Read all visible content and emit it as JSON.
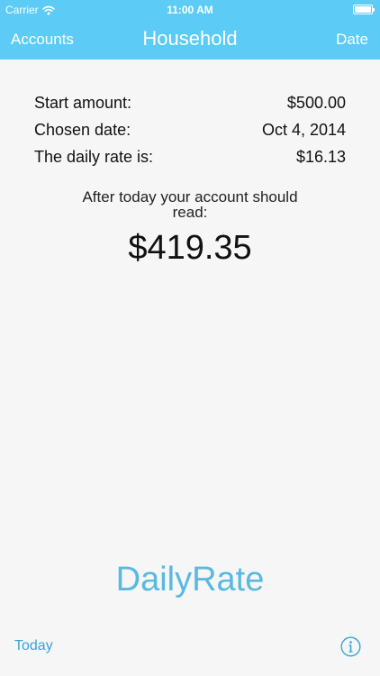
{
  "status_bar": {
    "carrier": "Carrier",
    "time": "11:00 AM",
    "wifi_icon": "wifi-icon",
    "battery_icon": "battery-icon"
  },
  "nav": {
    "left_label": "Accounts",
    "title": "Household",
    "right_label": "Date"
  },
  "details": {
    "rows": [
      {
        "label": "Start amount:",
        "value": "$500.00"
      },
      {
        "label": "Chosen date:",
        "value": "Oct 4, 2014"
      },
      {
        "label": "The daily rate is:",
        "value": "$16.13"
      }
    ]
  },
  "summary": {
    "message": "After today your account should read:",
    "amount": "$419.35"
  },
  "brand": {
    "name": "DailyRate"
  },
  "footer": {
    "today_label": "Today",
    "info_icon": "info-icon"
  },
  "colors": {
    "header": "#5ccbf5",
    "accent": "#36a3d8",
    "brand": "#5ab9df",
    "background": "#f6f6f6"
  }
}
